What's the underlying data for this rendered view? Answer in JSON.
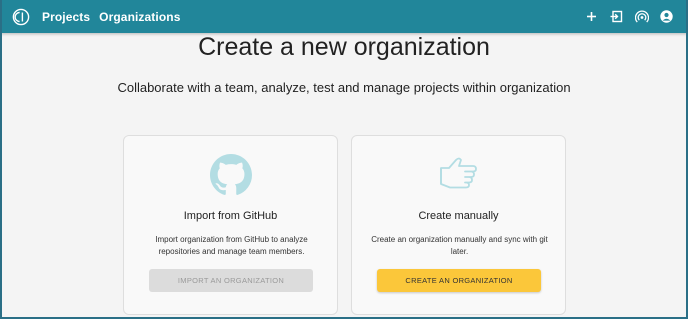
{
  "colors": {
    "topbar": "#21869a",
    "accent_button": "#fbc73a",
    "disabled_button": "#dcdcdc",
    "icon_tint": "#b3dde3"
  },
  "topbar": {
    "logo_icon": "app-logo-icon",
    "nav": [
      "Projects",
      "Organizations"
    ],
    "actions": [
      "plus-icon",
      "sign-in-icon",
      "broadcast-icon",
      "account-circle-icon"
    ]
  },
  "main": {
    "title": "Create a new organization",
    "subtitle": "Collaborate with a team, analyze, test and manage projects within organization"
  },
  "cards": {
    "github": {
      "icon": "github-icon",
      "title": "Import from GitHub",
      "description": "Import organization from GitHub to analyze repositories and manage team members.",
      "button": "IMPORT AN ORGANIZATION",
      "button_disabled": true
    },
    "manual": {
      "icon": "hand-icon",
      "title": "Create manually",
      "description": "Create an organization manually and sync with git later.",
      "button": "CREATE AN ORGANIZATION",
      "button_disabled": false
    }
  }
}
